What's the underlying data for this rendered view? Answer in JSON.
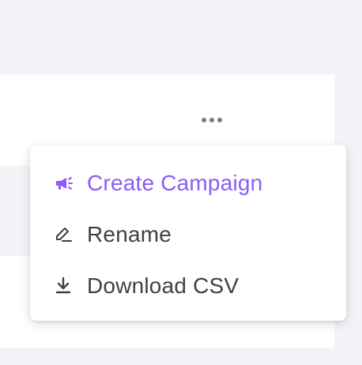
{
  "menu": {
    "items": [
      {
        "label": "Create Campaign",
        "icon": "megaphone-icon",
        "active": true
      },
      {
        "label": "Rename",
        "icon": "pencil-icon",
        "active": false
      },
      {
        "label": "Download CSV",
        "icon": "download-icon",
        "active": false
      }
    ]
  },
  "colors": {
    "accent": "#8b5cf6",
    "text": "#3e4049",
    "background": "#f3f4f8",
    "surface": "#ffffff",
    "kebab": "#777a84"
  },
  "icons": {
    "more": "more-horizontal-icon"
  }
}
